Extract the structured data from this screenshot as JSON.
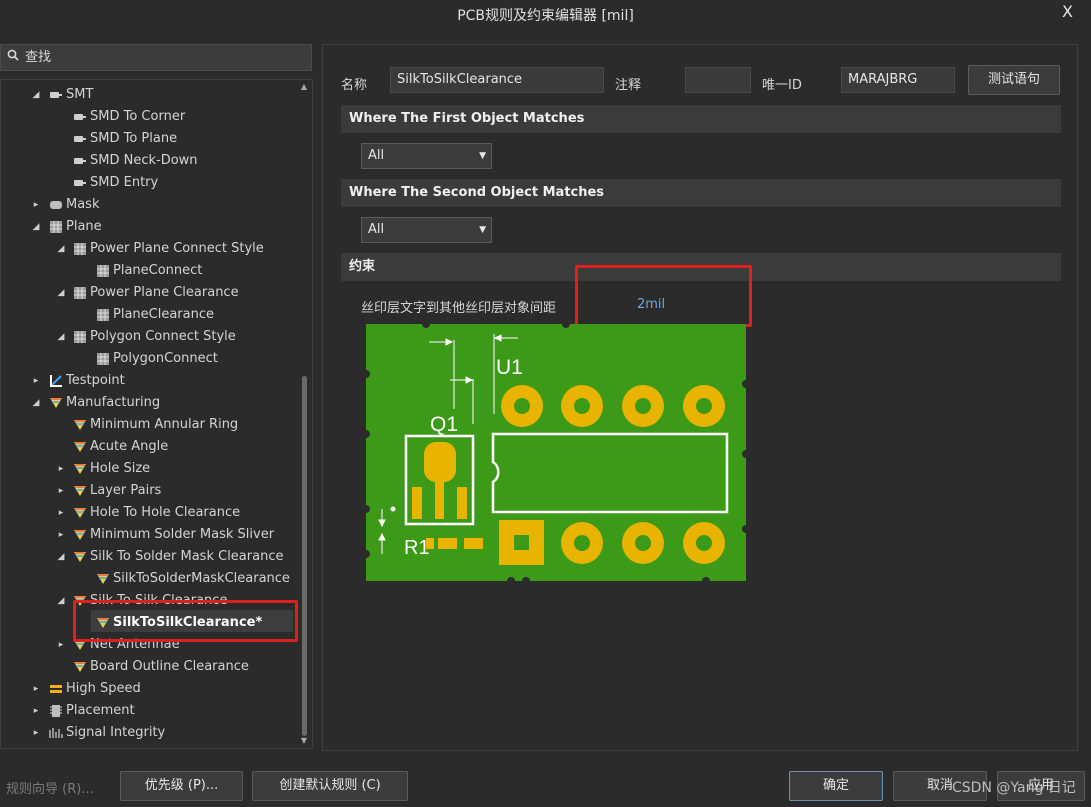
{
  "window": {
    "title": "PCB规则及约束编辑器 [mil]",
    "close_glyph": "X"
  },
  "search": {
    "label": "查找"
  },
  "tree": [
    {
      "label": "SMT",
      "icon": "smt-icon",
      "arrow": "expanded"
    },
    {
      "label": "SMD To Corner",
      "icon": "smt-rule-icon"
    },
    {
      "label": "SMD To Plane",
      "icon": "smt-rule-icon"
    },
    {
      "label": "SMD Neck-Down",
      "icon": "smt-rule-icon"
    },
    {
      "label": "SMD Entry",
      "icon": "smt-rule-icon"
    },
    {
      "label": "Mask",
      "icon": "mask-icon",
      "arrow": "collapsed"
    },
    {
      "label": "Plane",
      "icon": "plane-icon",
      "arrow": "expanded"
    },
    {
      "label": "Power Plane Connect Style",
      "icon": "plane-icon",
      "arrow": "expanded"
    },
    {
      "label": "PlaneConnect",
      "icon": "plane-icon"
    },
    {
      "label": "Power Plane Clearance",
      "icon": "plane-icon",
      "arrow": "expanded"
    },
    {
      "label": "PlaneClearance",
      "icon": "plane-icon"
    },
    {
      "label": "Polygon Connect Style",
      "icon": "plane-icon",
      "arrow": "expanded"
    },
    {
      "label": "PolygonConnect",
      "icon": "plane-icon"
    },
    {
      "label": "Testpoint",
      "icon": "testpoint-icon",
      "arrow": "collapsed"
    },
    {
      "label": "Manufacturing",
      "icon": "manufacturing-icon",
      "arrow": "expanded"
    },
    {
      "label": "Minimum Annular Ring",
      "icon": "manufacturing-icon"
    },
    {
      "label": "Acute Angle",
      "icon": "manufacturing-icon"
    },
    {
      "label": "Hole Size",
      "icon": "manufacturing-icon",
      "arrow": "collapsed"
    },
    {
      "label": "Layer Pairs",
      "icon": "manufacturing-icon",
      "arrow": "collapsed"
    },
    {
      "label": "Hole To Hole Clearance",
      "icon": "manufacturing-icon",
      "arrow": "collapsed"
    },
    {
      "label": "Minimum Solder Mask Sliver",
      "icon": "manufacturing-icon",
      "arrow": "collapsed"
    },
    {
      "label": "Silk To Solder Mask Clearance",
      "icon": "manufacturing-icon",
      "arrow": "expanded"
    },
    {
      "label": "SilkToSolderMaskClearance",
      "icon": "manufacturing-icon"
    },
    {
      "label": "Silk To Silk Clearance",
      "icon": "manufacturing-icon",
      "arrow": "expanded"
    },
    {
      "label": "SilkToSilkClearance*",
      "icon": "manufacturing-icon",
      "selected": true
    },
    {
      "label": "Net Antennae",
      "icon": "manufacturing-icon",
      "arrow": "collapsed"
    },
    {
      "label": "Board Outline Clearance",
      "icon": "manufacturing-icon"
    },
    {
      "label": "High Speed",
      "icon": "high-speed-icon",
      "arrow": "collapsed"
    },
    {
      "label": "Placement",
      "icon": "placement-icon",
      "arrow": "collapsed"
    },
    {
      "label": "Signal Integrity",
      "icon": "signal-integrity-icon",
      "arrow": "collapsed"
    }
  ],
  "rule": {
    "name_label": "名称",
    "name_value": "SilkToSilkClearance",
    "comment_label": "注释",
    "comment_value": "",
    "uid_label": "唯一ID",
    "uid_value": "MARAJBRG",
    "test_button": "测试语句"
  },
  "first_match": {
    "header": "Where The First Object Matches",
    "value": "All"
  },
  "second_match": {
    "header": "Where The Second Object Matches",
    "value": "All"
  },
  "constraints": {
    "header": "约束",
    "label": "丝印层文字到其他丝印层对象间距",
    "value": "2mil"
  },
  "diagram": {
    "u1_label": "U1",
    "q1_label": "Q1",
    "r1_label": "R1",
    "board_color": "#3c9a18",
    "pad_color": "#e8b400",
    "silk_color": "#ffffff"
  },
  "bottom": {
    "wizard": "规则向导 (R)...",
    "priority": "优先级 (P)...",
    "create_default": "创建默认规则 (C)",
    "ok": "确定",
    "cancel": "取消",
    "apply": "应用"
  },
  "watermark": "CSDN @Yang 日记"
}
